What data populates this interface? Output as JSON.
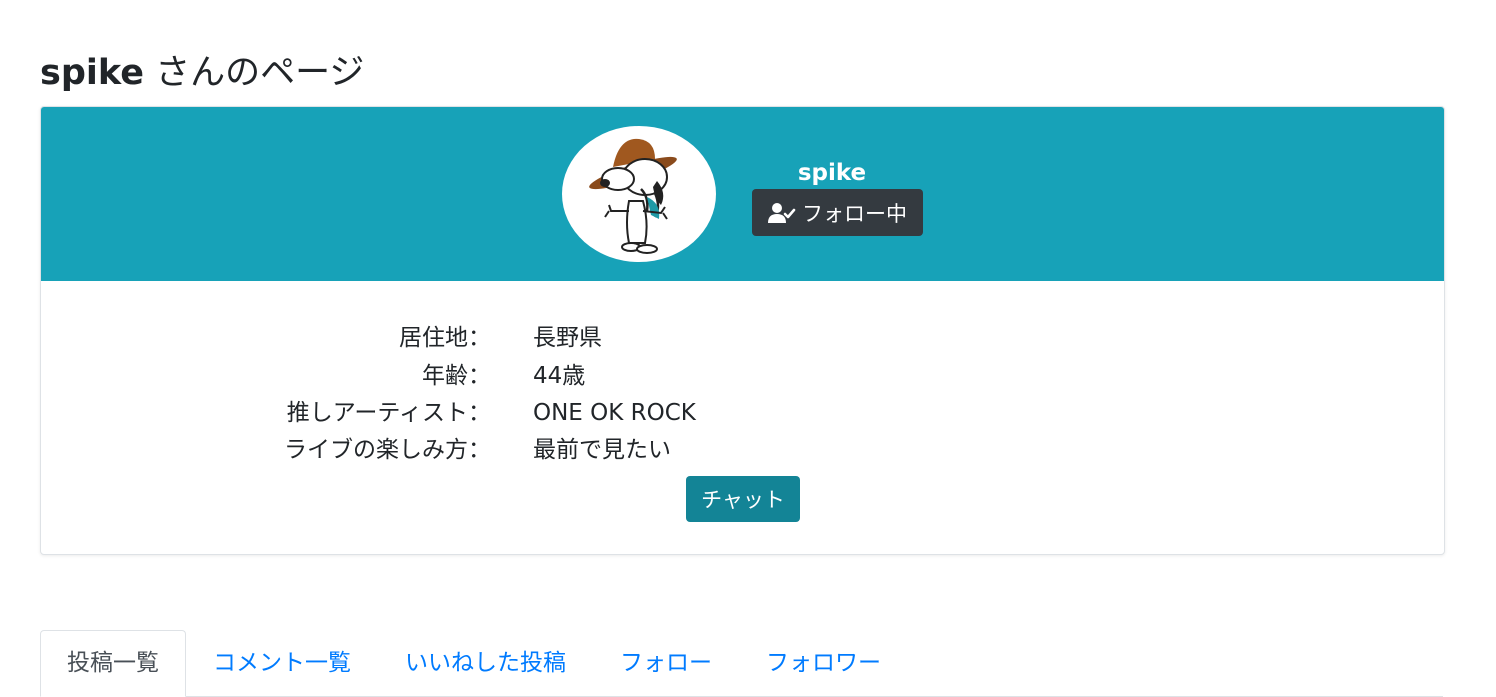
{
  "page": {
    "title_user": "spike",
    "title_suffix": " さんのページ"
  },
  "profile": {
    "name": "spike",
    "avatar_icon": "snoopy-spike-avatar",
    "follow_button_label": "フォロー中",
    "follow_icon": "user-check-icon",
    "header_color": "#17a2b8"
  },
  "info": [
    {
      "label": "居住地：",
      "value": "長野県"
    },
    {
      "label": "年齢：",
      "value": "44歳"
    },
    {
      "label": "推しアーティスト：",
      "value": "ONE OK ROCK"
    },
    {
      "label": "ライブの楽しみ方：",
      "value": "最前で見たい"
    }
  ],
  "chat_button_label": "チャット",
  "tabs": [
    {
      "label": "投稿一覧",
      "active": true
    },
    {
      "label": "コメント一覧",
      "active": false
    },
    {
      "label": "いいねした投稿",
      "active": false
    },
    {
      "label": "フォロー",
      "active": false
    },
    {
      "label": "フォロワー",
      "active": false
    }
  ]
}
